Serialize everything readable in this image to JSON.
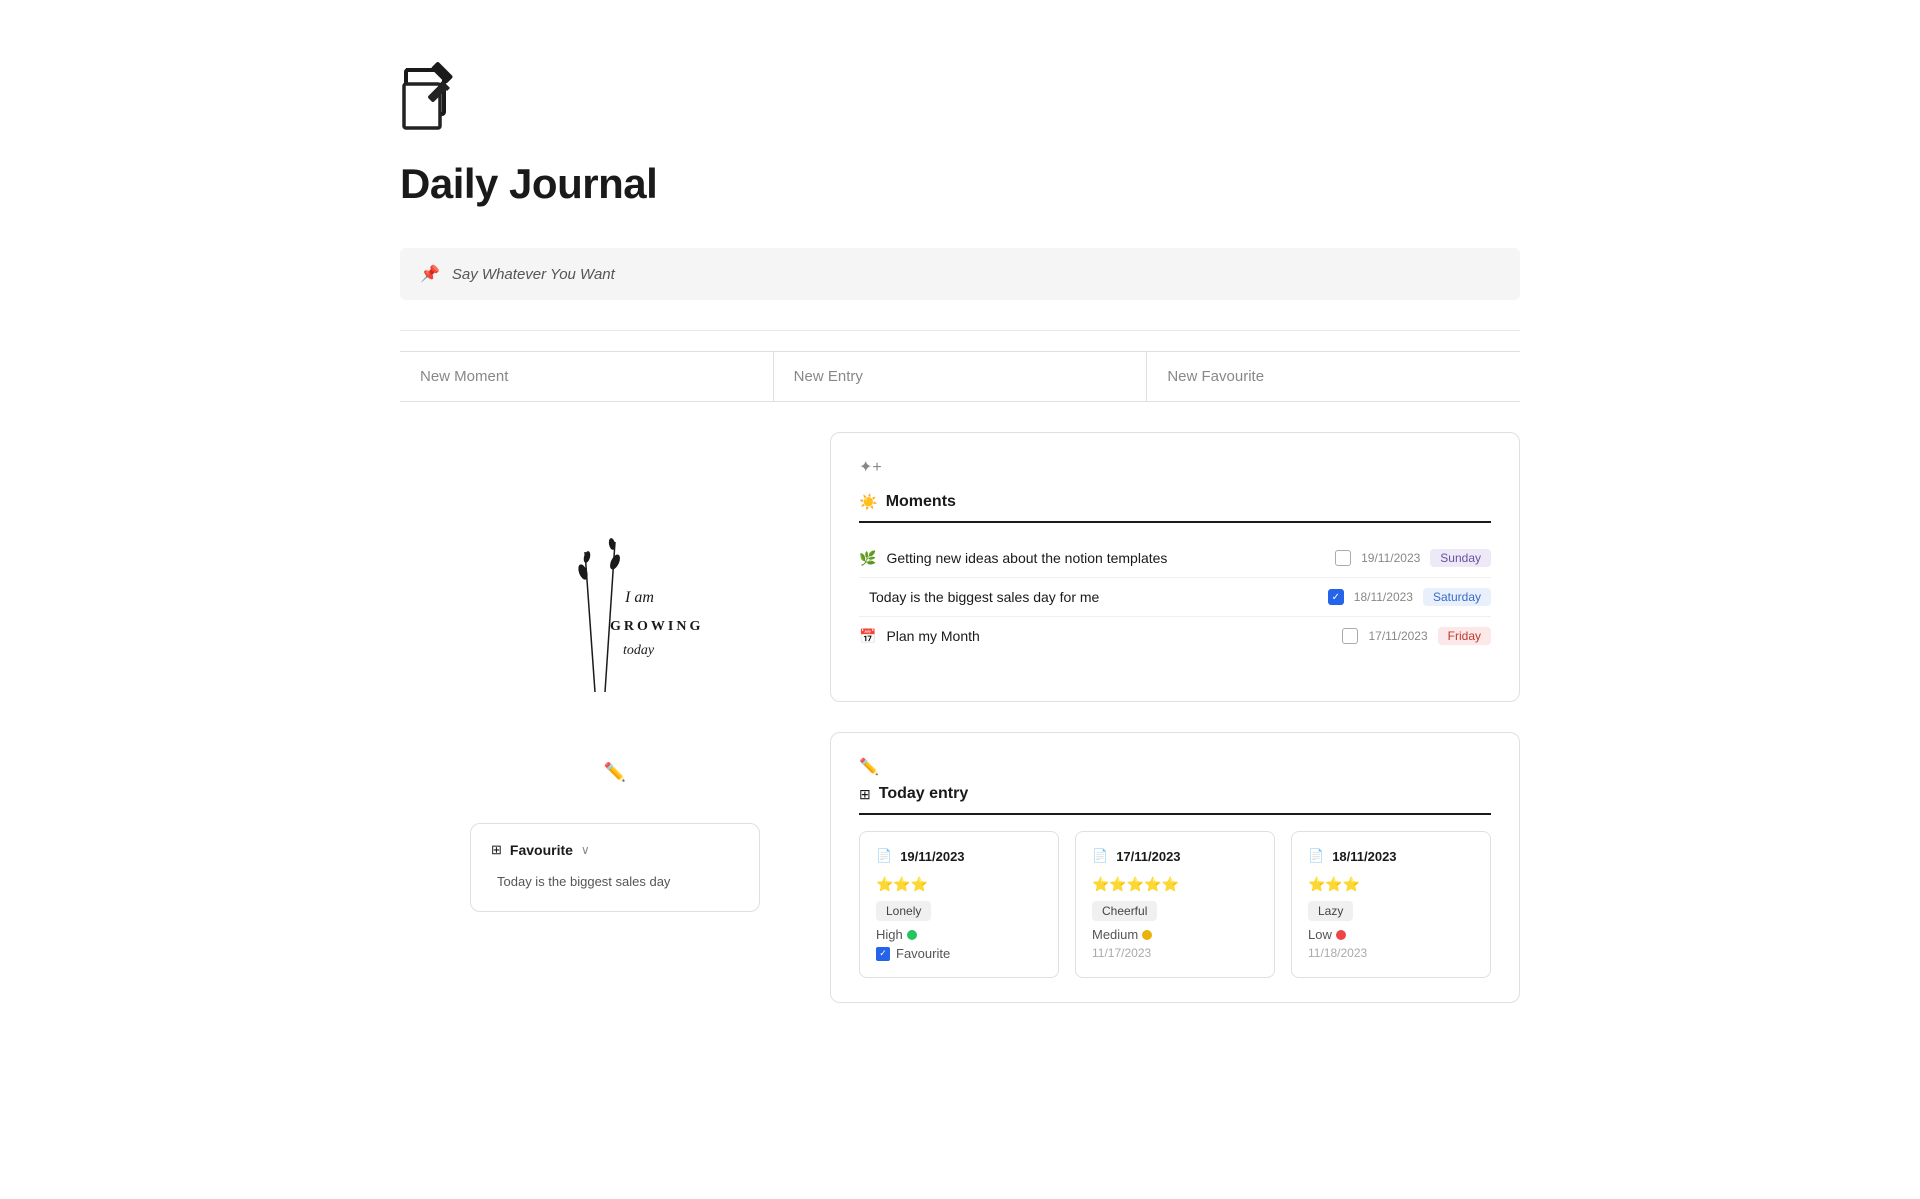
{
  "page": {
    "title": "Daily Journal"
  },
  "pinned": {
    "text": "Say Whatever You Want"
  },
  "new_buttons": {
    "moment_label": "New Moment",
    "entry_label": "New Entry",
    "favourite_label": "New Favourite"
  },
  "moments_card": {
    "title": "Moments",
    "sparkle": "✦",
    "items": [
      {
        "icon": "🌿",
        "text": "Getting new ideas about the notion templates",
        "checked": false,
        "date": "19/11/2023",
        "day": "Sunday",
        "day_class": "day-sunday"
      },
      {
        "icon": "</>",
        "text": "Today is the biggest sales day for me",
        "checked": true,
        "date": "18/11/2023",
        "day": "Saturday",
        "day_class": "day-saturday"
      },
      {
        "icon": "📅",
        "text": "Plan my Month",
        "checked": false,
        "date": "17/11/2023",
        "day": "Friday",
        "day_class": "day-friday"
      }
    ]
  },
  "today_entry_card": {
    "title": "Today entry",
    "entries": [
      {
        "date": "19/11/2023",
        "stars": "⭐⭐⭐",
        "mood": "Lonely",
        "energy_label": "High",
        "energy_dot_class": "energy-green",
        "entry_date": "",
        "favourite": true,
        "favourite_label": "Favourite"
      },
      {
        "date": "17/11/2023",
        "stars": "⭐⭐⭐⭐⭐",
        "mood": "Cheerful",
        "energy_label": "Medium",
        "energy_dot_class": "energy-yellow",
        "entry_date": "11/17/2023",
        "favourite": false,
        "favourite_label": ""
      },
      {
        "date": "18/11/2023",
        "stars": "⭐⭐⭐",
        "mood": "Lazy",
        "energy_label": "Low",
        "energy_dot_class": "energy-red",
        "entry_date": "11/18/2023",
        "favourite": false,
        "favourite_label": ""
      }
    ]
  },
  "favourite_mini": {
    "title": "Favourite",
    "item": "Today is the biggest sales day"
  },
  "illustration": {
    "text1": "I am",
    "text2": "GROWING",
    "text3": "today"
  }
}
